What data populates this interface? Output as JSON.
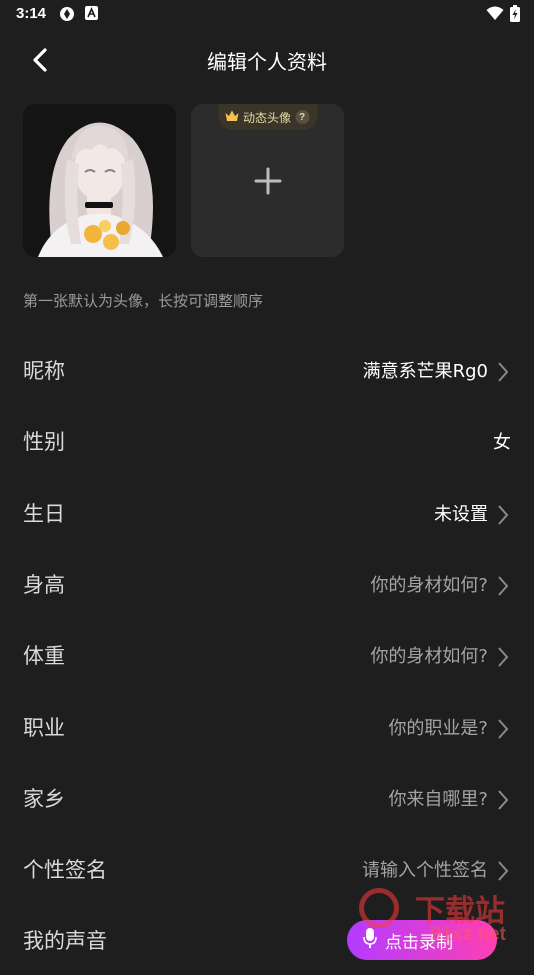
{
  "status": {
    "time": "3:14",
    "icons": [
      "sync-icon",
      "a-notification-icon",
      "wifi-icon",
      "battery-charging-icon"
    ]
  },
  "header": {
    "title": "编辑个人资料",
    "back_icon": "chevron-left-icon"
  },
  "avatars": {
    "dynamic_badge": "动态头像",
    "help_mark": "?",
    "add_icon": "plus-icon",
    "hint": "第一张默认为头像，长按可调整顺序"
  },
  "profile": {
    "rows": [
      {
        "label": "昵称",
        "value": "满意系芒果Rg0",
        "placeholder": false,
        "arrow": true
      },
      {
        "label": "性别",
        "value": "女",
        "placeholder": false,
        "arrow": false
      },
      {
        "label": "生日",
        "value": "未设置",
        "placeholder": false,
        "arrow": true
      },
      {
        "label": "身高",
        "value": "你的身材如何?",
        "placeholder": true,
        "arrow": true
      },
      {
        "label": "体重",
        "value": "你的身材如何?",
        "placeholder": true,
        "arrow": true
      },
      {
        "label": "职业",
        "value": "你的职业是?",
        "placeholder": true,
        "arrow": true
      },
      {
        "label": "家乡",
        "value": "你来自哪里?",
        "placeholder": true,
        "arrow": true
      },
      {
        "label": "个性签名",
        "value": "请输入个性签名",
        "placeholder": true,
        "arrow": true
      },
      {
        "label": "我的声音",
        "value": "",
        "placeholder": false,
        "arrow": false
      }
    ]
  },
  "voice": {
    "record_label": "点击录制",
    "mic_icon": "microphone-icon"
  },
  "watermark": {
    "line1": "下载站",
    "line2": "91xz.net"
  },
  "colors": {
    "background": "#1e1e1e",
    "tile": "#2c2c2c",
    "badge_text": "#e9d9a8",
    "voice_gradient_start": "#b23cff",
    "voice_gradient_end": "#ff3fb3",
    "placeholder_text": "#a3a3a3"
  }
}
